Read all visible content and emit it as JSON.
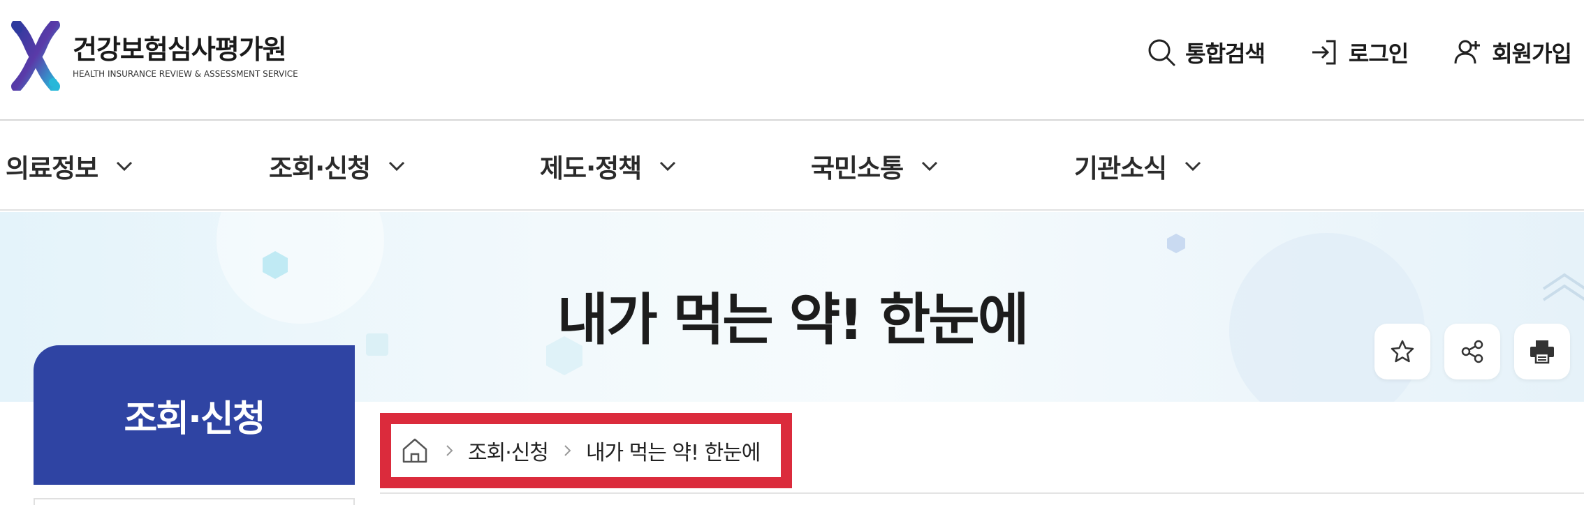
{
  "logo": {
    "name_kr": "건강보험심사평가원",
    "name_en": "HEALTH INSURANCE REVIEW & ASSESSMENT SERVICE",
    "colors": {
      "primary": "#2f3a9e",
      "accent": "#27b7d9"
    }
  },
  "util": {
    "search": {
      "label": "통합검색",
      "icon": "search-icon"
    },
    "login": {
      "label": "로그인",
      "icon": "login-icon"
    },
    "join": {
      "label": "회원가입",
      "icon": "user-plus-icon"
    }
  },
  "gnb": {
    "items": [
      {
        "label": "의료정보"
      },
      {
        "label": "조회·신청"
      },
      {
        "label": "제도·정책"
      },
      {
        "label": "국민소통"
      },
      {
        "label": "기관소식"
      }
    ]
  },
  "visual": {
    "title": "내가 먹는 약! 한눈에"
  },
  "tools": [
    {
      "icon": "star-icon",
      "name": "favorite"
    },
    {
      "icon": "share-icon",
      "name": "share"
    },
    {
      "icon": "print-icon",
      "name": "print"
    }
  ],
  "lnb": {
    "title": "조회·신청",
    "color": "#2f44a3"
  },
  "breadcrumb": {
    "home_icon": "home-icon",
    "items": [
      "조회·신청",
      "내가 먹는 약! 한눈에"
    ],
    "highlight_color": "#db2b3c"
  }
}
